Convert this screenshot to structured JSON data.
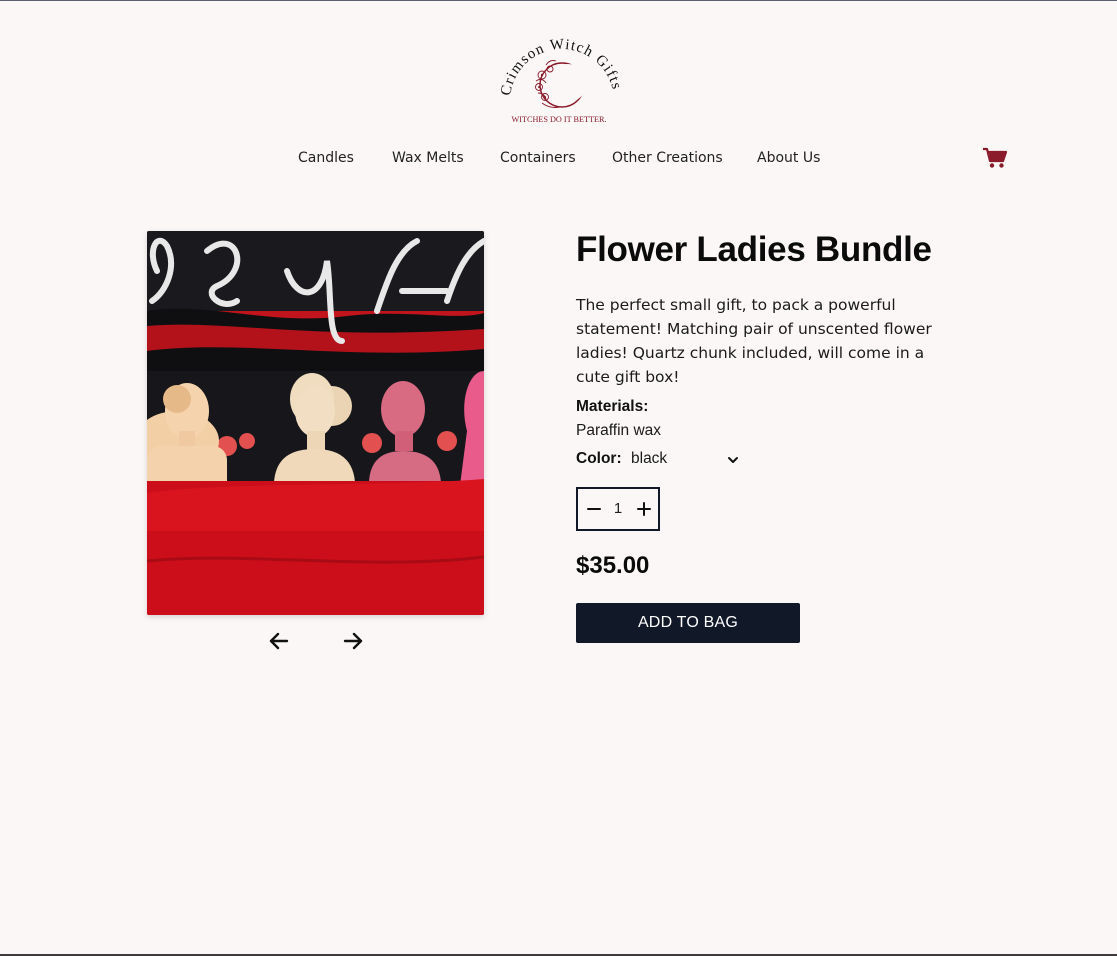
{
  "brand": {
    "name": "Crimson Witch Gifts",
    "tagline": "WITCHES DO IT BETTER.",
    "accent_color": "#8b1a2b"
  },
  "nav": {
    "items": [
      {
        "label": "Candles"
      },
      {
        "label": "Wax Melts"
      },
      {
        "label": "Containers"
      },
      {
        "label": "Other Creations"
      },
      {
        "label": "About Us"
      }
    ],
    "cart_icon": "shopping-cart-icon"
  },
  "gallery": {
    "image_alt": "Flower lady candles in front of red backdrop",
    "prev_icon": "arrow-left-icon",
    "next_icon": "arrow-right-icon"
  },
  "product": {
    "title": "Flower Ladies Bundle",
    "description": "The perfect small gift, to pack a powerful statement! Matching pair of unscented flower ladies! Quartz chunk included, will come in a cute gift box!",
    "materials_label": "Materials:",
    "materials_value": "Paraffin wax",
    "color_label": "Color:",
    "color_value": "black",
    "quantity": "1",
    "price": "$35.00",
    "add_to_bag_label": "ADD TO BAG",
    "button_color": "#111827"
  }
}
